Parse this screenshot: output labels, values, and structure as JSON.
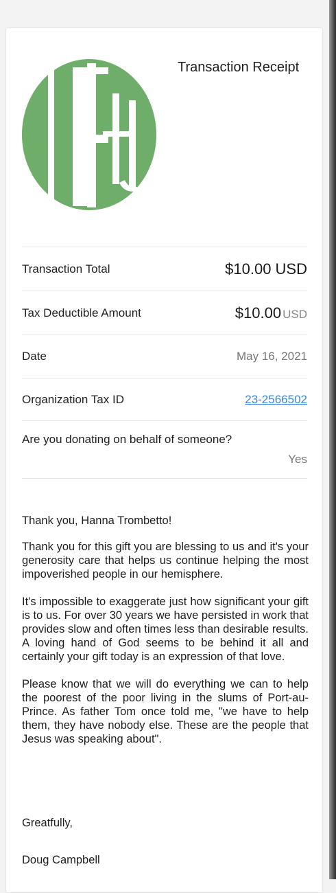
{
  "receipt": {
    "title": "Transaction Receipt",
    "brand_color": "#6fae6a",
    "logo_icon": "hf-monogram-logo-icon"
  },
  "rows": {
    "transaction_total": {
      "label": "Transaction Total",
      "value": "$10.00 USD"
    },
    "tax_deductible": {
      "label": "Tax Deductible Amount",
      "amount": "$10.00",
      "unit": "USD"
    },
    "date": {
      "label": "Date",
      "value": "May 16, 2021"
    },
    "org_tax_id": {
      "label": "Organization Tax ID",
      "value": "23-2566502",
      "link_color": "#3a86d6"
    },
    "on_behalf": {
      "question": "Are you donating on behalf of someone?",
      "answer": "Yes"
    }
  },
  "message": {
    "greeting": "Thank you, Hanna Trombetto!",
    "paragraphs": [
      "Thank you for this gift you are blessing to us and it's your generosity care that helps us continue helping the most impoverished people in our hemisphere.",
      "It's impossible to exaggerate just how significant your gift is to us. For over 30 years we have persisted in work that provides slow and often times less than desirable results. A loving hand of God seems to be behind it all and certainly your gift today is an expression of that love.",
      "Please know that we will do everything we can to help the poorest of the poor living in the slums of Port-au-Prince. As father Tom once told me, \"we have to help them, they have nobody else. These are the people that Jesus was speaking about\"."
    ],
    "closing": "Greatfully,",
    "signature": "Doug Campbell"
  }
}
